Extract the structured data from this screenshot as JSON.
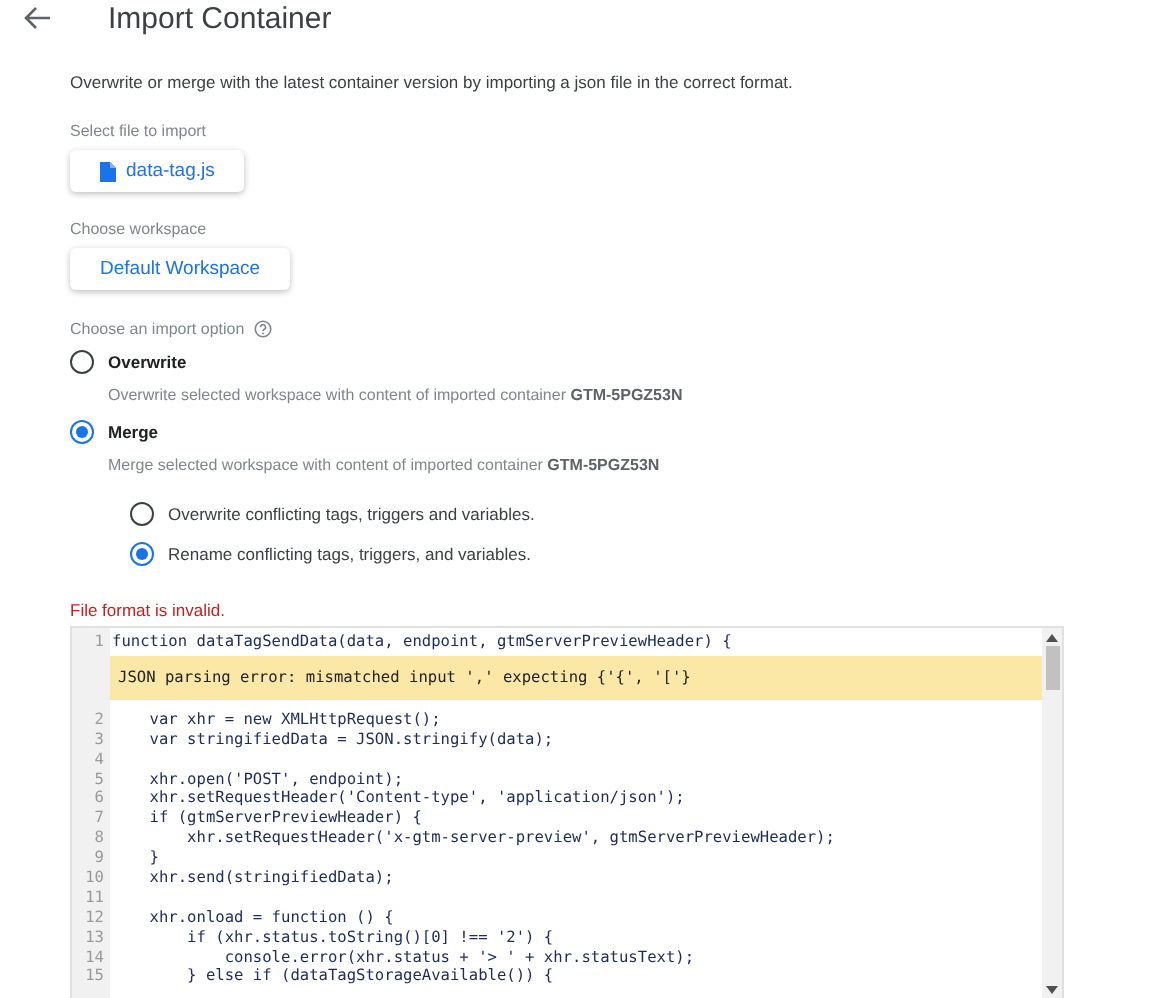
{
  "header": {
    "title": "Import Container"
  },
  "description": "Overwrite or merge with the latest container version by importing a json file in the correct format.",
  "file_section": {
    "label": "Select file to import",
    "file_name": "data-tag.js"
  },
  "workspace_section": {
    "label": "Choose workspace",
    "workspace": "Default Workspace"
  },
  "import_option": {
    "label": "Choose an import option",
    "options": [
      {
        "label": "Overwrite",
        "selected": false,
        "description": "Overwrite selected workspace with content of imported container **GTM-5PGZ53N**"
      },
      {
        "label": "Merge",
        "selected": true,
        "description": "Merge selected workspace with content of imported container **GTM-5PGZ53N**"
      }
    ],
    "merge_options": [
      {
        "label": "Overwrite conflicting tags, triggers and variables.",
        "selected": false
      },
      {
        "label": "Rename conflicting tags, triggers, and variables.",
        "selected": true
      }
    ]
  },
  "error_message": "File format is invalid.",
  "editor": {
    "lines": [
      {
        "kind": "code",
        "number": "1",
        "text": "function dataTagSendData(data, endpoint, gtmServerPreviewHeader) {"
      },
      {
        "kind": "error",
        "text": "JSON parsing error: mismatched input ',' expecting {'{', '['}"
      },
      {
        "kind": "code",
        "number": "2",
        "text": "    var xhr = new XMLHttpRequest();"
      },
      {
        "kind": "code",
        "number": "3",
        "text": "    var stringifiedData = JSON.stringify(data);"
      },
      {
        "kind": "code",
        "number": "4"
      },
      {
        "kind": "code",
        "number": "5",
        "text": "    xhr.open('POST', endpoint);"
      },
      {
        "kind": "code",
        "number": "6",
        "text": "    xhr.setRequestHeader('Content-type', 'application/json');"
      },
      {
        "kind": "code",
        "number": "7",
        "text": "    if (gtmServerPreviewHeader) {"
      },
      {
        "kind": "code",
        "number": "8",
        "text": "        xhr.setRequestHeader('x-gtm-server-preview', gtmServerPreviewHeader);"
      },
      {
        "kind": "code",
        "number": "9",
        "text": "    }"
      },
      {
        "kind": "code",
        "number": "10",
        "text": "    xhr.send(stringifiedData);"
      },
      {
        "kind": "code",
        "number": "11"
      },
      {
        "kind": "code",
        "number": "12",
        "text": "    xhr.onload = function () {"
      },
      {
        "kind": "code",
        "number": "13",
        "text": "        if (xhr.status.toString()[0] !== '2') {"
      },
      {
        "kind": "code",
        "number": "14",
        "text": "            console.error(xhr.status + '> ' + xhr.statusText);"
      },
      {
        "kind": "code",
        "number": "15",
        "text": "        } else if (dataTagStorageAvailable()) {"
      }
    ]
  }
}
